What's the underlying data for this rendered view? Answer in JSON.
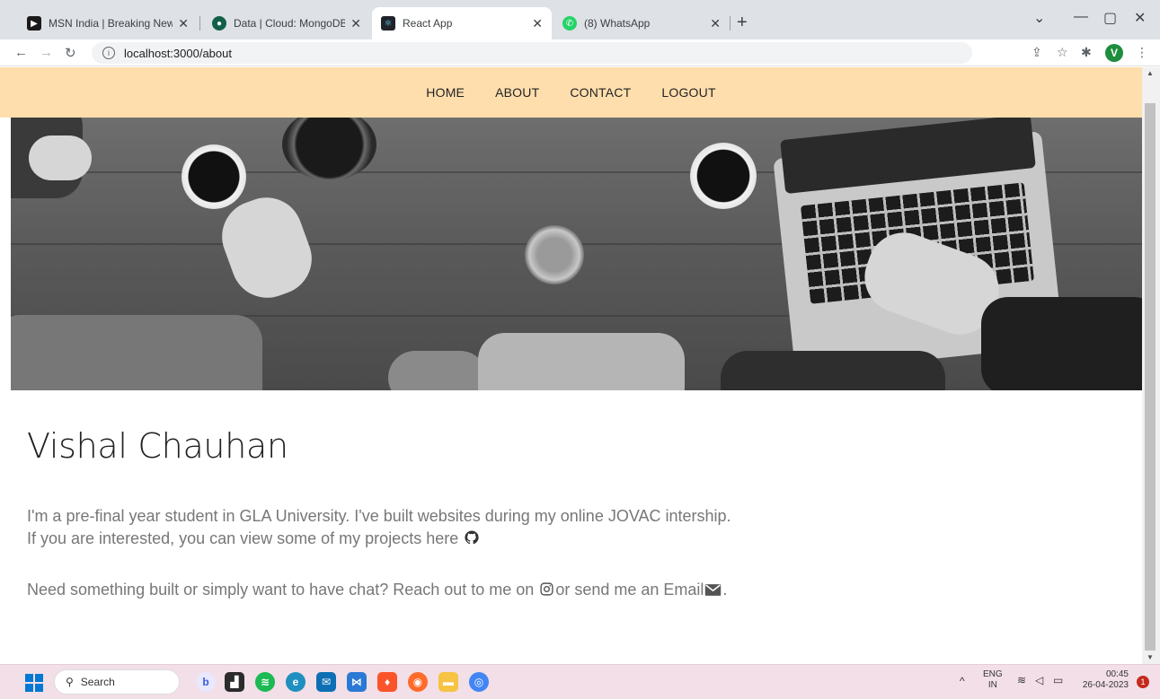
{
  "browser": {
    "tabs": [
      {
        "title": "MSN India | Breaking News, Ente",
        "favicon": "msn-icon",
        "color": "#1a1a1a",
        "active": false
      },
      {
        "title": "Data | Cloud: MongoDB Cloud",
        "favicon": "mongodb-icon",
        "color": "#116149",
        "active": false
      },
      {
        "title": "React App",
        "favicon": "react-icon",
        "color": "#20232a",
        "active": true
      },
      {
        "title": "(8) WhatsApp",
        "favicon": "whatsapp-icon",
        "color": "#25d366",
        "active": false
      }
    ],
    "new_tab_label": "+",
    "url": "localhost:3000/about",
    "profile_initial": "V"
  },
  "navbar": {
    "items": [
      "HOME",
      "ABOUT",
      "CONTACT",
      "LOGOUT"
    ],
    "background": "#ffdead"
  },
  "about": {
    "name": "Vishal Chauhan",
    "line1": "I'm a pre-final year student in GLA University. I've built websites during my online JOVAC intership.",
    "line2": "If you are interested, you can view some of my projects here",
    "line3_before": "Need something built or simply want to have chat? Reach out to me on",
    "line3_middle": "or send me an Email",
    "line3_end": "."
  },
  "taskbar": {
    "search_label": "Search",
    "lang_top": "ENG",
    "lang_bottom": "IN",
    "time": "00:45",
    "date": "26-04-2023",
    "notification_count": "1"
  }
}
